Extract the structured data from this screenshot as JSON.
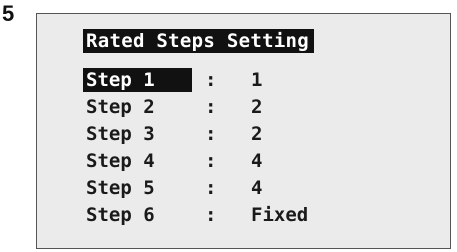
{
  "figure": {
    "number": "5"
  },
  "screen": {
    "title": "Rated Steps Setting",
    "separator": ":",
    "rows": [
      {
        "label": "Step  1",
        "value": "1",
        "selected": true
      },
      {
        "label": "Step  2",
        "value": "2",
        "selected": false
      },
      {
        "label": "Step  3",
        "value": "2",
        "selected": false
      },
      {
        "label": "Step  4",
        "value": "4",
        "selected": false
      },
      {
        "label": "Step  5",
        "value": "4",
        "selected": false
      },
      {
        "label": "Step  6",
        "value": "Fixed",
        "selected": false
      }
    ]
  },
  "colors": {
    "panel_background": "#ebebeb",
    "highlight": "#111111",
    "highlight_text": "#ffffff",
    "text": "#1a1a1a"
  }
}
